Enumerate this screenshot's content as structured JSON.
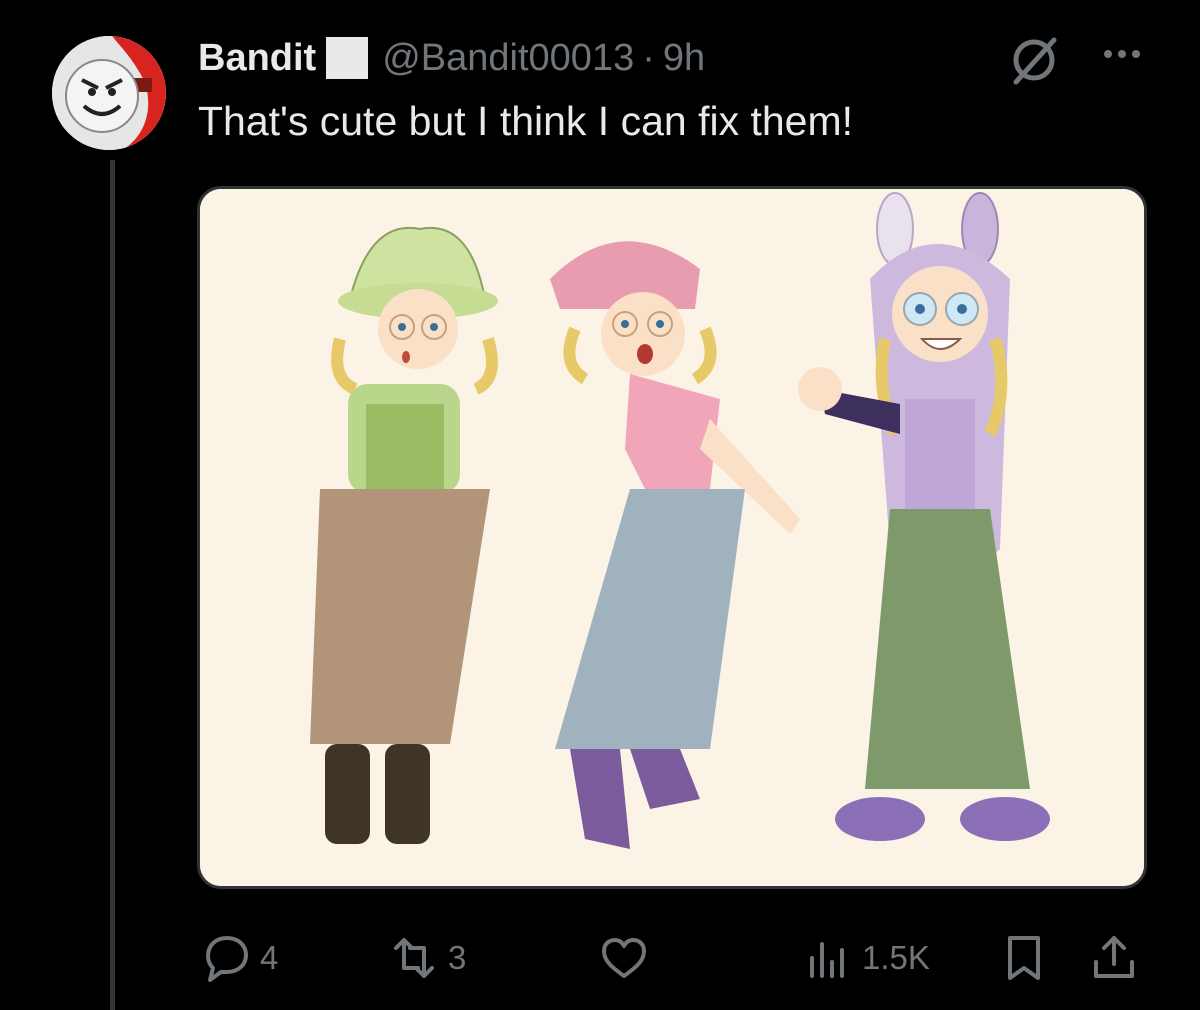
{
  "post": {
    "author_name": "Bandit",
    "handle": "@Bandit00013",
    "separator": "·",
    "time": "9h",
    "text": "That's cute but I think I can fix them!",
    "image_alt": "Illustration of three outfits on the same blonde girl with braids and round glasses: green bucket hat with brown skirt, pink beanie with denim skirt, bunny hood with green skirt"
  },
  "actions": {
    "replies": "4",
    "reposts": "3",
    "views": "1.5K"
  },
  "icons": {
    "reply": "reply-bubble-icon",
    "repost": "repost-arrows-icon",
    "like": "heart-icon",
    "views": "views-bars-icon",
    "bookmark": "bookmark-icon",
    "share": "share-upload-icon",
    "grok": "grok-slash-icon",
    "more": "more-dots-icon"
  },
  "colors": {
    "background": "#000000",
    "primary_text": "#e7e9ea",
    "secondary_text": "#71767b",
    "media_background": "#fbf3e6"
  }
}
